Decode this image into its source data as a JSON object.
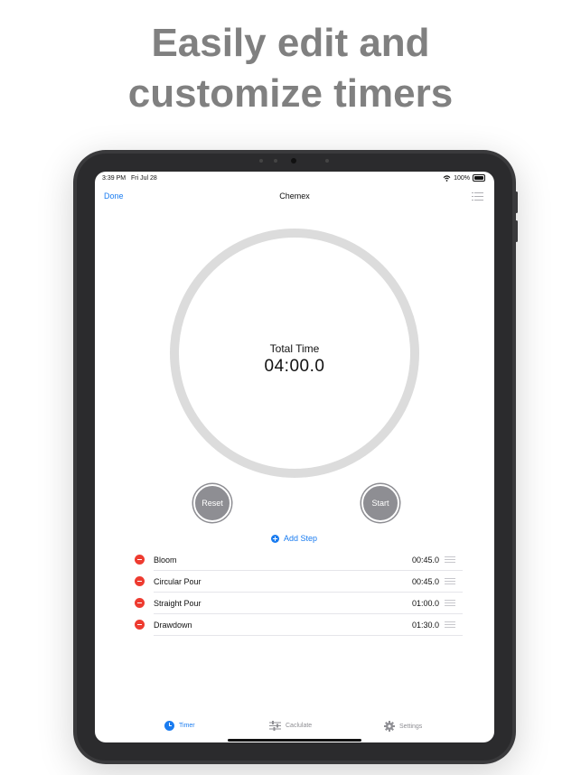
{
  "headline": {
    "line1": "Easily edit and",
    "line2": "customize timers"
  },
  "status_bar": {
    "time": "3:39 PM",
    "date": "Fri Jul 28",
    "battery": "100%"
  },
  "nav": {
    "done_label": "Done",
    "title": "Chemex",
    "list_icon": "list-icon"
  },
  "timer": {
    "total_label": "Total Time",
    "total_value": "04:00.0"
  },
  "controls": {
    "reset_label": "Reset",
    "start_label": "Start"
  },
  "add_step_label": "Add Step",
  "steps": [
    {
      "name": "Bloom",
      "time": "00:45.0"
    },
    {
      "name": "Circular Pour",
      "time": "00:45.0"
    },
    {
      "name": "Straight Pour",
      "time": "01:00.0"
    },
    {
      "name": "Drawdown",
      "time": "01:30.0"
    }
  ],
  "tabs": [
    {
      "label": "Timer",
      "icon": "timer-icon",
      "active": true
    },
    {
      "label": "Caclulate",
      "icon": "sliders-icon",
      "active": false
    },
    {
      "label": "Settings",
      "icon": "gear-icon",
      "active": false
    }
  ],
  "colors": {
    "accent": "#1a7cf0",
    "delete": "#ee3b30",
    "ring": "#dcdcdc",
    "button": "#8e8e93",
    "headline": "#808080"
  }
}
